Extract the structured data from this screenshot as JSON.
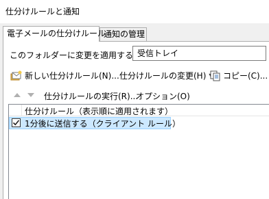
{
  "window": {
    "title": "仕分けルールと通知"
  },
  "tabs": [
    {
      "label": "電子メールの仕分けルール",
      "active": true
    },
    {
      "label": "通知の管理",
      "active": false
    }
  ],
  "folder": {
    "label": "このフォルダーに変更を適用する(F):",
    "value": "受信トレイ"
  },
  "toolbar": {
    "new_rule": "新しい仕分けルール(N)...",
    "change_rule": "仕分けルールの変更(H)",
    "copy": "コピー(C)...",
    "run_rules": "仕分けルールの実行(R)...",
    "options": "オプション(O)"
  },
  "rules_list": {
    "header": "仕分けルール（表示順に適用されます）",
    "rows": [
      {
        "label": "1分後に送信する（クライアント ルール）",
        "checked": true,
        "selected": true
      }
    ]
  },
  "icons": {
    "new_rule": "new-rule-icon",
    "copy": "copy-icon",
    "move_up": "arrow-up-icon",
    "move_down": "arrow-down-icon",
    "checkbox": "checkmark-icon"
  },
  "colors": {
    "selection_bg": "#cce8ff",
    "selection_border": "#99d1ff",
    "dialog_bg": "#f0f0f0"
  }
}
